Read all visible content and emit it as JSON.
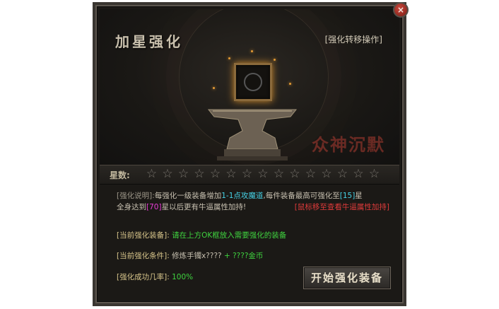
{
  "window": {
    "title": "加星强化",
    "transfer_link": "[强化转移操作]",
    "close_icon": "×"
  },
  "stars": {
    "label": "星数:",
    "count": 15,
    "filled": 0
  },
  "description": {
    "prefix": "[强化说明]:",
    "text1": "每强化一级装备增加",
    "bonus": "1-1点攻魔道",
    "text2": ",每件装备最高可强化至",
    "max_level": "[15]",
    "text3": "星",
    "text4": "全身达到",
    "full_level": "[70]",
    "text5": "星",
    "text6": "以后更有牛逼属性加持!",
    "hint": "[鼠标移至查看牛逼属性加持]"
  },
  "info": {
    "equip_label": "[当前强化装备]:",
    "equip_value": "请在上方OK框放入需要强化的装备",
    "cond_label": "[当前强化条件]:",
    "cond_item": "修炼手镯x????",
    "cond_plus": "+",
    "cond_gold": "????金币",
    "rate_label": "[强化成功几率]:",
    "rate_value": "100%"
  },
  "start_button": "开始强化装备",
  "logo_text": "众神沉默",
  "colors": {
    "accent_cyan": "#46d2e6",
    "accent_green": "#3fd23f",
    "accent_red": "#e03b3b",
    "accent_magenta": "#ea3cd8"
  }
}
